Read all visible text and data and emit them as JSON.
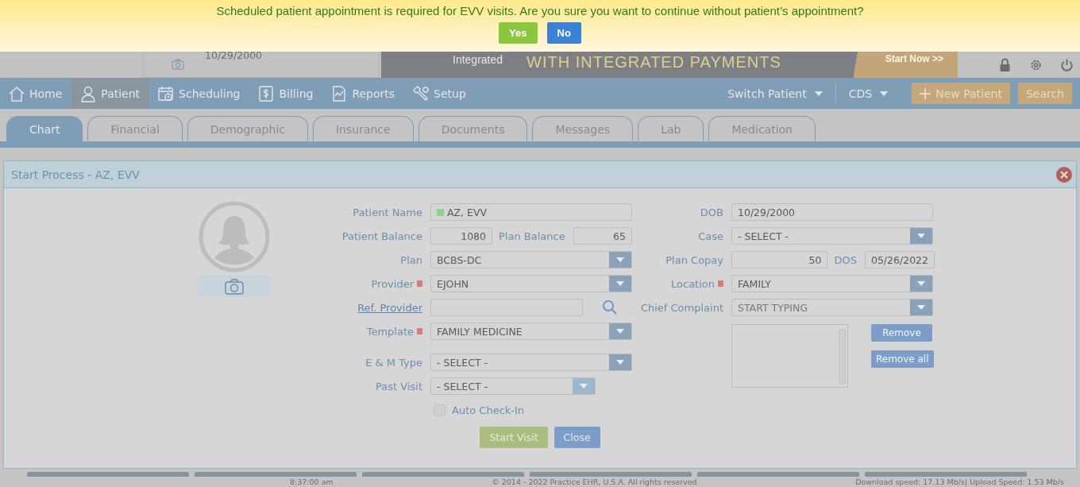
{
  "confirm": {
    "message": "Scheduled patient appointment is required for EVV visits. Are you sure you want to continue without patient’s appointment?",
    "buttons": [
      {
        "label": "Yes",
        "kind": "yes"
      },
      {
        "label": "No",
        "kind": "no"
      }
    ]
  },
  "header": {
    "dob": "10/29/2000",
    "ad": {
      "line1": "Integrated",
      "line2": "WITH INTEGRATED PAYMENTS",
      "cta": "Start Now >>"
    }
  },
  "nav": {
    "items": [
      {
        "label": "Home",
        "selected": false
      },
      {
        "label": "Patient",
        "selected": true
      },
      {
        "label": "Scheduling",
        "selected": false
      },
      {
        "label": "Billing",
        "selected": false
      },
      {
        "label": "Reports",
        "selected": false
      },
      {
        "label": "Setup",
        "selected": false
      }
    ],
    "menus": [
      {
        "label": "Switch Patient"
      },
      {
        "label": "CDS"
      }
    ],
    "buttons": [
      {
        "label": "New Patient",
        "kind": "add"
      },
      {
        "label": "Search",
        "kind": "plain"
      }
    ]
  },
  "tabs": [
    {
      "label": "Chart",
      "selected": true
    },
    {
      "label": "Financial",
      "selected": false
    },
    {
      "label": "Demographic",
      "selected": false
    },
    {
      "label": "Insurance",
      "selected": false
    },
    {
      "label": "Documents",
      "selected": false
    },
    {
      "label": "Messages",
      "selected": false
    },
    {
      "label": "Lab",
      "selected": false
    },
    {
      "label": "Medication",
      "selected": false
    }
  ],
  "dialog": {
    "title": "Start Process - AZ, EVV",
    "left_fields": [
      {
        "kind": "text",
        "label": "Patient Name",
        "value": "AZ, EVV",
        "color": "#8fd08f"
      },
      {
        "kind": "pair",
        "label": "Patient Balance",
        "value": "1080",
        "label2": "Plan Balance",
        "value2": "65"
      },
      {
        "kind": "select",
        "label": "Plan",
        "value": "BCBS-DC"
      },
      {
        "kind": "select",
        "label": "Provider",
        "value": "EJOHN",
        "required": true
      },
      {
        "kind": "lookup",
        "label": "Ref. Provider"
      },
      {
        "kind": "select",
        "label": "Template",
        "value": "FAMILY MEDICINE",
        "required": true
      },
      {
        "kind": "select",
        "label": "E & M Type",
        "value": "- SELECT -"
      },
      {
        "kind": "short_select",
        "label": "Past Visit",
        "value": "- SELECT -"
      }
    ],
    "auto_checkin": {
      "label": "Auto Check-In",
      "checked": false
    },
    "right_fields": [
      {
        "kind": "text",
        "label": "DOB",
        "value": "10/29/2000"
      },
      {
        "kind": "select",
        "label": "Case",
        "value": "- SELECT -"
      },
      {
        "kind": "pair",
        "label": "Plan Copay",
        "value": "50",
        "label2": "DOS",
        "value2": "05/26/2022"
      },
      {
        "kind": "select",
        "label": "Location",
        "value": "FAMILY",
        "required": true
      },
      {
        "kind": "select",
        "label": "Chief Complaint",
        "placeholder": "START TYPING"
      }
    ],
    "list_buttons": [
      {
        "label": "Remove"
      },
      {
        "label": "Remove all"
      }
    ],
    "buttons": [
      {
        "label": "Start Visit",
        "kind": "primary"
      },
      {
        "label": "Close",
        "kind": "secondary"
      }
    ]
  },
  "footer": {
    "time": "8:37:00 am",
    "copyright": "© 2014 - 2022 Practice EHR, U.S.A. All rights reserved",
    "speed": "Download speed: 17.13 Mb/s| Upload Speed: 1.53 Mb/s"
  }
}
